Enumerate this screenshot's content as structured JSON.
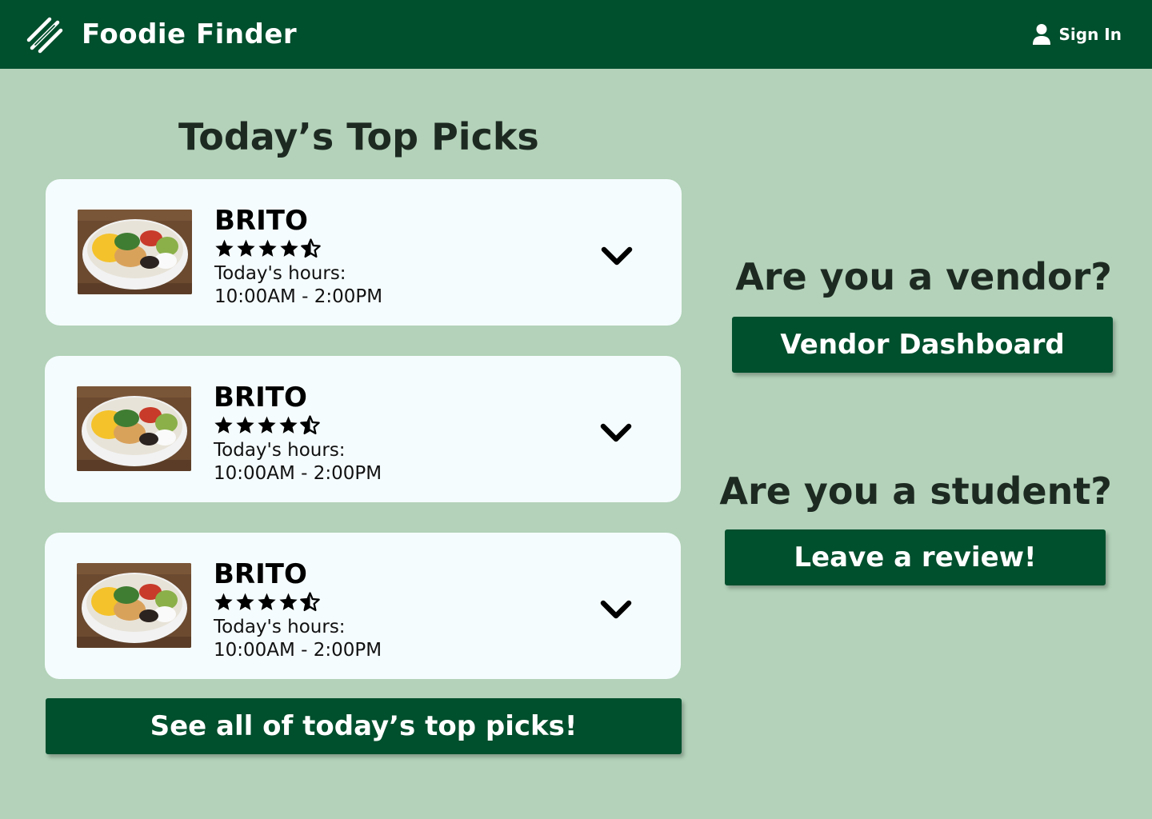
{
  "header": {
    "title": "Foodie Finder",
    "logo_icon": "hot-dog-logo-icon",
    "signin_label": "Sign In",
    "signin_icon": "user-icon",
    "background": "#004f2d"
  },
  "main": {
    "section_title": "Today’s Top Picks",
    "cards": [
      {
        "name": "BRITO",
        "rating": 4.5,
        "rating_max": 5,
        "hours_label": "Today's hours:",
        "hours": "10:00AM - 2:00PM",
        "image": "burrito-bowl-photo",
        "expand_icon": "chevron-down-icon"
      },
      {
        "name": "BRITO",
        "rating": 4.5,
        "rating_max": 5,
        "hours_label": "Today's hours:",
        "hours": "10:00AM - 2:00PM",
        "image": "burrito-bowl-photo",
        "expand_icon": "chevron-down-icon"
      },
      {
        "name": "BRITO",
        "rating": 4.5,
        "rating_max": 5,
        "hours_label": "Today's hours:",
        "hours": "10:00AM - 2:00PM",
        "image": "burrito-bowl-photo",
        "expand_icon": "chevron-down-icon"
      }
    ],
    "see_all_label": "See all of today’s top picks!"
  },
  "side": {
    "vendor_question": "Are you a vendor?",
    "vendor_button": "Vendor Dashboard",
    "student_question": "Are you a student?",
    "student_button": "Leave a review!"
  },
  "colors": {
    "page_background": "#b3d2b9",
    "brand_green": "#004f2d",
    "card_background": "#f5fcfe"
  }
}
